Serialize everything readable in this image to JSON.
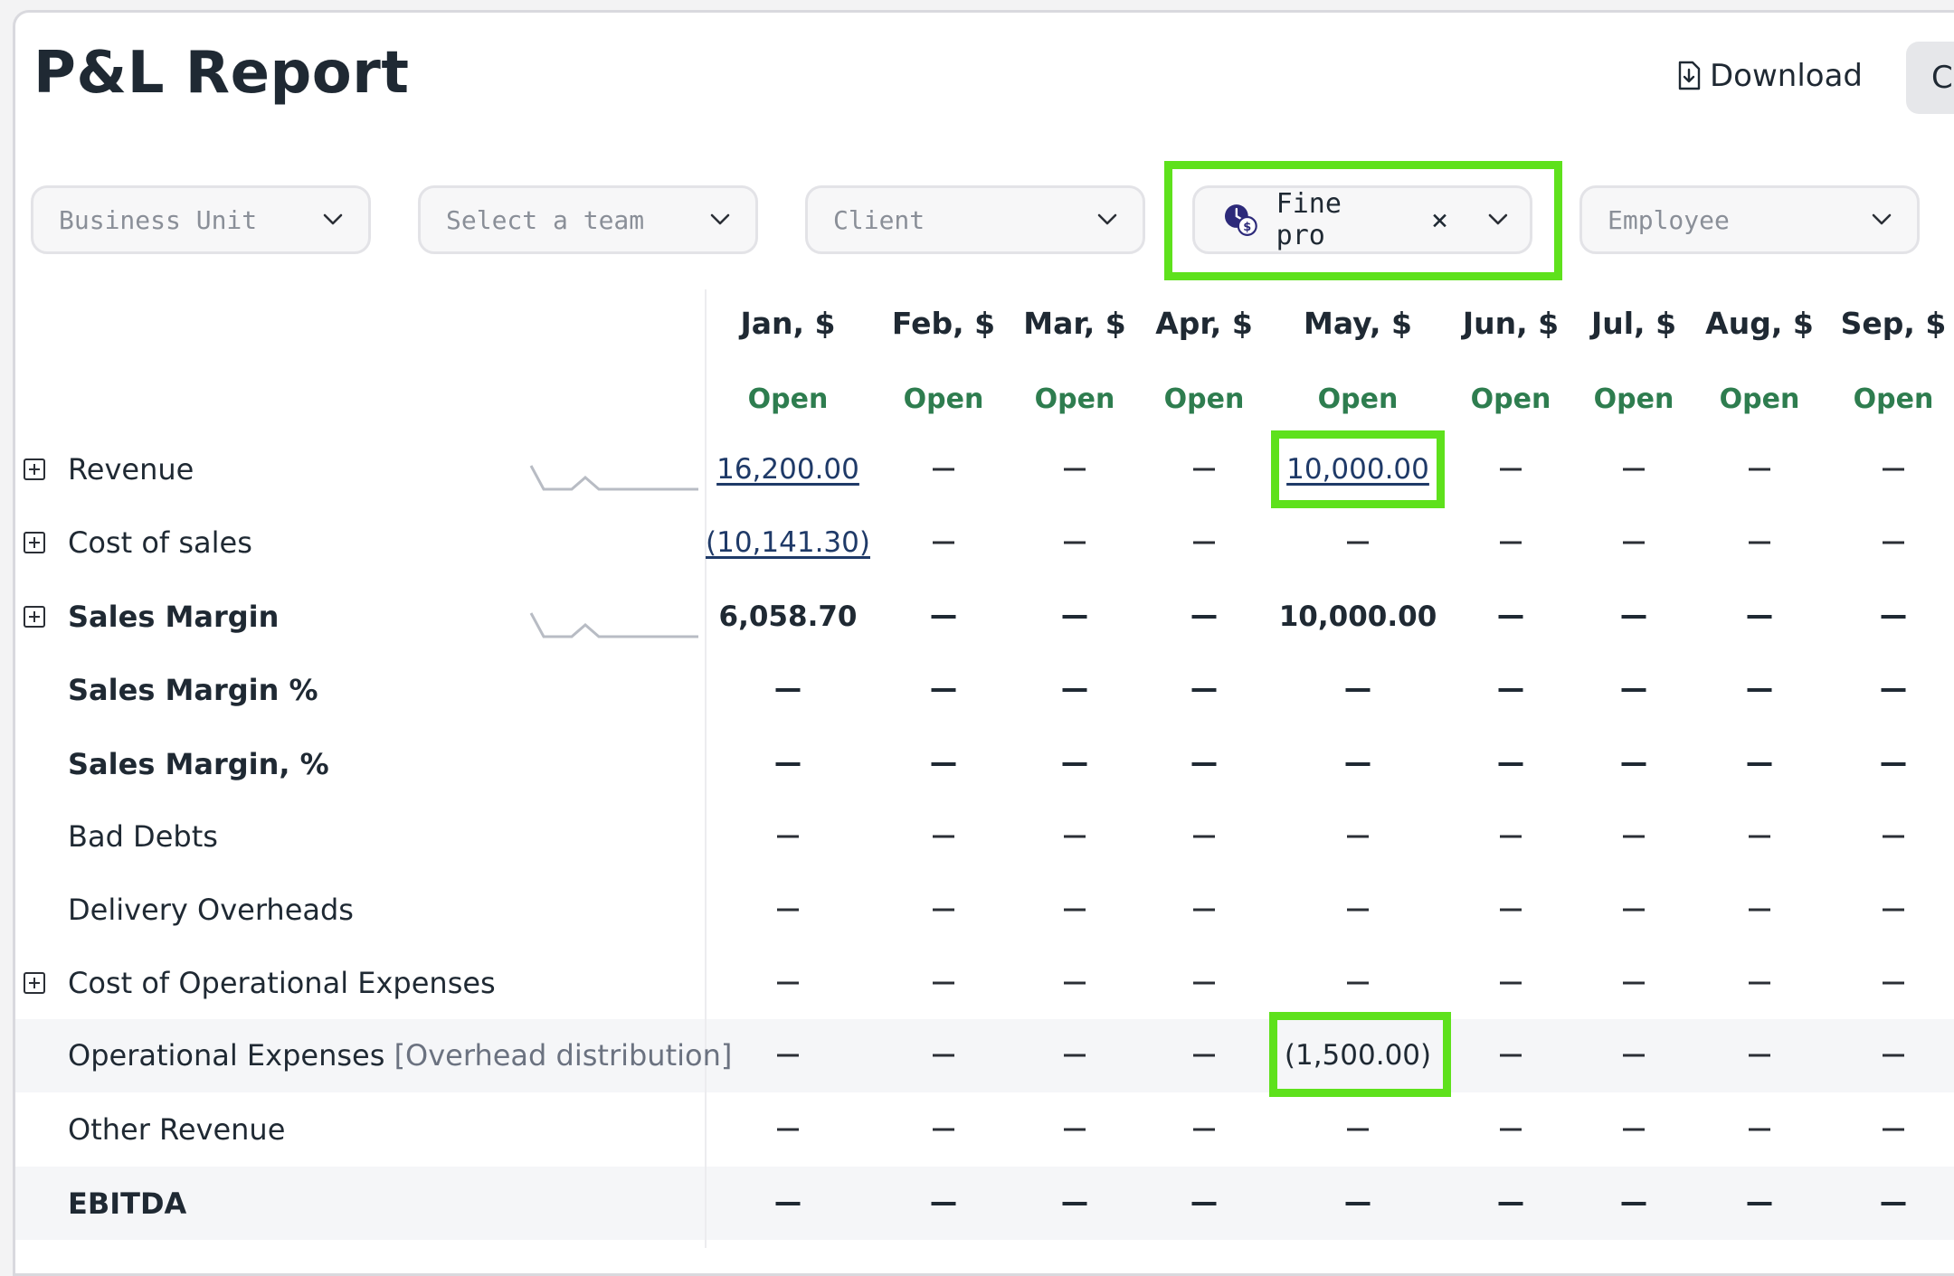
{
  "page": {
    "title": "P&L Report",
    "download_label": "Download",
    "close_label": "Cl"
  },
  "filters": {
    "business_unit": "Business Unit",
    "team": "Select a team",
    "client": "Client",
    "project_value": "Fine pro",
    "employee": "Employee"
  },
  "columns": [
    {
      "label": "Jan, $",
      "status": "Open"
    },
    {
      "label": "Feb, $",
      "status": "Open"
    },
    {
      "label": "Mar, $",
      "status": "Open"
    },
    {
      "label": "Apr, $",
      "status": "Open"
    },
    {
      "label": "May, $",
      "status": "Open"
    },
    {
      "label": "Jun, $",
      "status": "Open"
    },
    {
      "label": "Jul, $",
      "status": "Open"
    },
    {
      "label": "Aug, $",
      "status": "Open"
    },
    {
      "label": "Sep, $",
      "status": "Open"
    }
  ],
  "rows": [
    {
      "label": "Revenue",
      "suffix": "",
      "expandable": true,
      "bold": false,
      "sparkline": true,
      "link": true,
      "cells": [
        "16,200.00",
        "—",
        "—",
        "—",
        "10,000.00",
        "—",
        "—",
        "—",
        "—"
      ]
    },
    {
      "label": "Cost of sales",
      "suffix": "",
      "expandable": true,
      "bold": false,
      "sparkline": false,
      "link": true,
      "cells": [
        "(10,141.30)",
        "—",
        "—",
        "—",
        "—",
        "—",
        "—",
        "—",
        "—"
      ]
    },
    {
      "label": "Sales Margin",
      "suffix": "",
      "expandable": true,
      "bold": true,
      "sparkline": true,
      "link": false,
      "cells": [
        "6,058.70",
        "—",
        "—",
        "—",
        "10,000.00",
        "—",
        "—",
        "—",
        "—"
      ]
    },
    {
      "label": "Sales Margin %",
      "suffix": "",
      "expandable": false,
      "bold": true,
      "sparkline": false,
      "link": false,
      "cells": [
        "—",
        "—",
        "—",
        "—",
        "—",
        "—",
        "—",
        "—",
        "—"
      ]
    },
    {
      "label": "Sales Margin, %",
      "suffix": "",
      "expandable": false,
      "bold": true,
      "sparkline": false,
      "link": false,
      "cells": [
        "—",
        "—",
        "—",
        "—",
        "—",
        "—",
        "—",
        "—",
        "—"
      ]
    },
    {
      "label": "Bad Debts",
      "suffix": "",
      "expandable": false,
      "bold": false,
      "sparkline": false,
      "link": false,
      "cells": [
        "—",
        "—",
        "—",
        "—",
        "—",
        "—",
        "—",
        "—",
        "—"
      ]
    },
    {
      "label": "Delivery Overheads",
      "suffix": "",
      "expandable": false,
      "bold": false,
      "sparkline": false,
      "link": false,
      "cells": [
        "—",
        "—",
        "—",
        "—",
        "—",
        "—",
        "—",
        "—",
        "—"
      ]
    },
    {
      "label": "Cost of Operational Expenses",
      "suffix": "",
      "expandable": true,
      "bold": false,
      "sparkline": false,
      "link": false,
      "cells": [
        "—",
        "—",
        "—",
        "—",
        "—",
        "—",
        "—",
        "—",
        "—"
      ]
    },
    {
      "label": "Operational Expenses",
      "suffix": "[Overhead distribution]",
      "expandable": false,
      "bold": false,
      "sparkline": false,
      "link": false,
      "cells": [
        "—",
        "—",
        "—",
        "—",
        "(1,500.00)",
        "—",
        "—",
        "—",
        "—"
      ]
    },
    {
      "label": "Other Revenue",
      "suffix": "",
      "expandable": false,
      "bold": false,
      "sparkline": false,
      "link": false,
      "cells": [
        "—",
        "—",
        "—",
        "—",
        "—",
        "—",
        "—",
        "—",
        "—"
      ]
    },
    {
      "label": "EBITDA",
      "suffix": "",
      "expandable": false,
      "bold": true,
      "sparkline": false,
      "link": false,
      "cells": [
        "—",
        "—",
        "—",
        "—",
        "—",
        "—",
        "—",
        "—",
        "—"
      ]
    }
  ],
  "colors": {
    "highlight": "#5ee11c",
    "status_open": "#2e7d4f",
    "link": "#1f3a68"
  }
}
